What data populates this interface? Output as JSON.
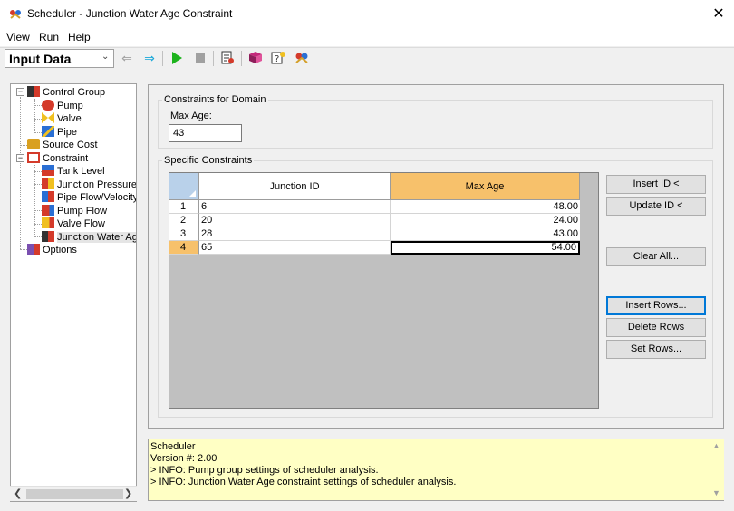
{
  "window": {
    "title": "Scheduler - Junction Water Age Constraint",
    "close_glyph": "✕"
  },
  "menu": [
    {
      "label": "View"
    },
    {
      "label": "Run"
    },
    {
      "label": "Help"
    }
  ],
  "toolbar": {
    "view_select": "Input Data"
  },
  "tree": {
    "items": [
      {
        "label": "Control Group",
        "icon": "control-group-icon"
      },
      {
        "label": "Pump",
        "icon": "pump-icon"
      },
      {
        "label": "Valve",
        "icon": "valve-icon"
      },
      {
        "label": "Pipe",
        "icon": "pipe-icon"
      },
      {
        "label": "Source Cost",
        "icon": "source-cost-icon"
      },
      {
        "label": "Constraint",
        "icon": "constraint-icon"
      },
      {
        "label": "Tank Level",
        "icon": "tank-level-icon"
      },
      {
        "label": "Junction Pressure",
        "icon": "junction-pressure-icon"
      },
      {
        "label": "Pipe Flow/Velocity",
        "icon": "pipe-flow-icon"
      },
      {
        "label": "Pump Flow",
        "icon": "pump-flow-icon"
      },
      {
        "label": "Valve Flow",
        "icon": "valve-flow-icon"
      },
      {
        "label": "Junction Water Age",
        "icon": "junction-water-age-icon"
      },
      {
        "label": "Options",
        "icon": "options-icon"
      }
    ]
  },
  "domain": {
    "group_label": "Constraints for Domain",
    "max_age_label": "Max Age:",
    "max_age_value": "43"
  },
  "specific": {
    "group_label": "Specific Constraints",
    "columns": [
      "Junction ID",
      "Max Age"
    ],
    "rows": [
      {
        "num": "1",
        "id": "6",
        "max_age": "48.00"
      },
      {
        "num": "2",
        "id": "20",
        "max_age": "24.00"
      },
      {
        "num": "3",
        "id": "28",
        "max_age": "43.00"
      },
      {
        "num": "4",
        "id": "65",
        "max_age": "54.00"
      }
    ]
  },
  "buttons": {
    "insert_id": "Insert ID <",
    "update_id": "Update ID <",
    "clear_all": "Clear All...",
    "insert_rows": "Insert Rows...",
    "delete_rows": "Delete Rows",
    "set_rows": "Set Rows..."
  },
  "log": {
    "lines": [
      "Scheduler",
      "Version #: 2.00",
      "> INFO: Pump group settings of scheduler analysis.",
      "> INFO: Junction Water Age constraint settings of scheduler analysis."
    ]
  },
  "colors": {
    "selection": "#f7c16b",
    "log_bg": "#ffffc4",
    "corner": "#b9d1ea"
  }
}
